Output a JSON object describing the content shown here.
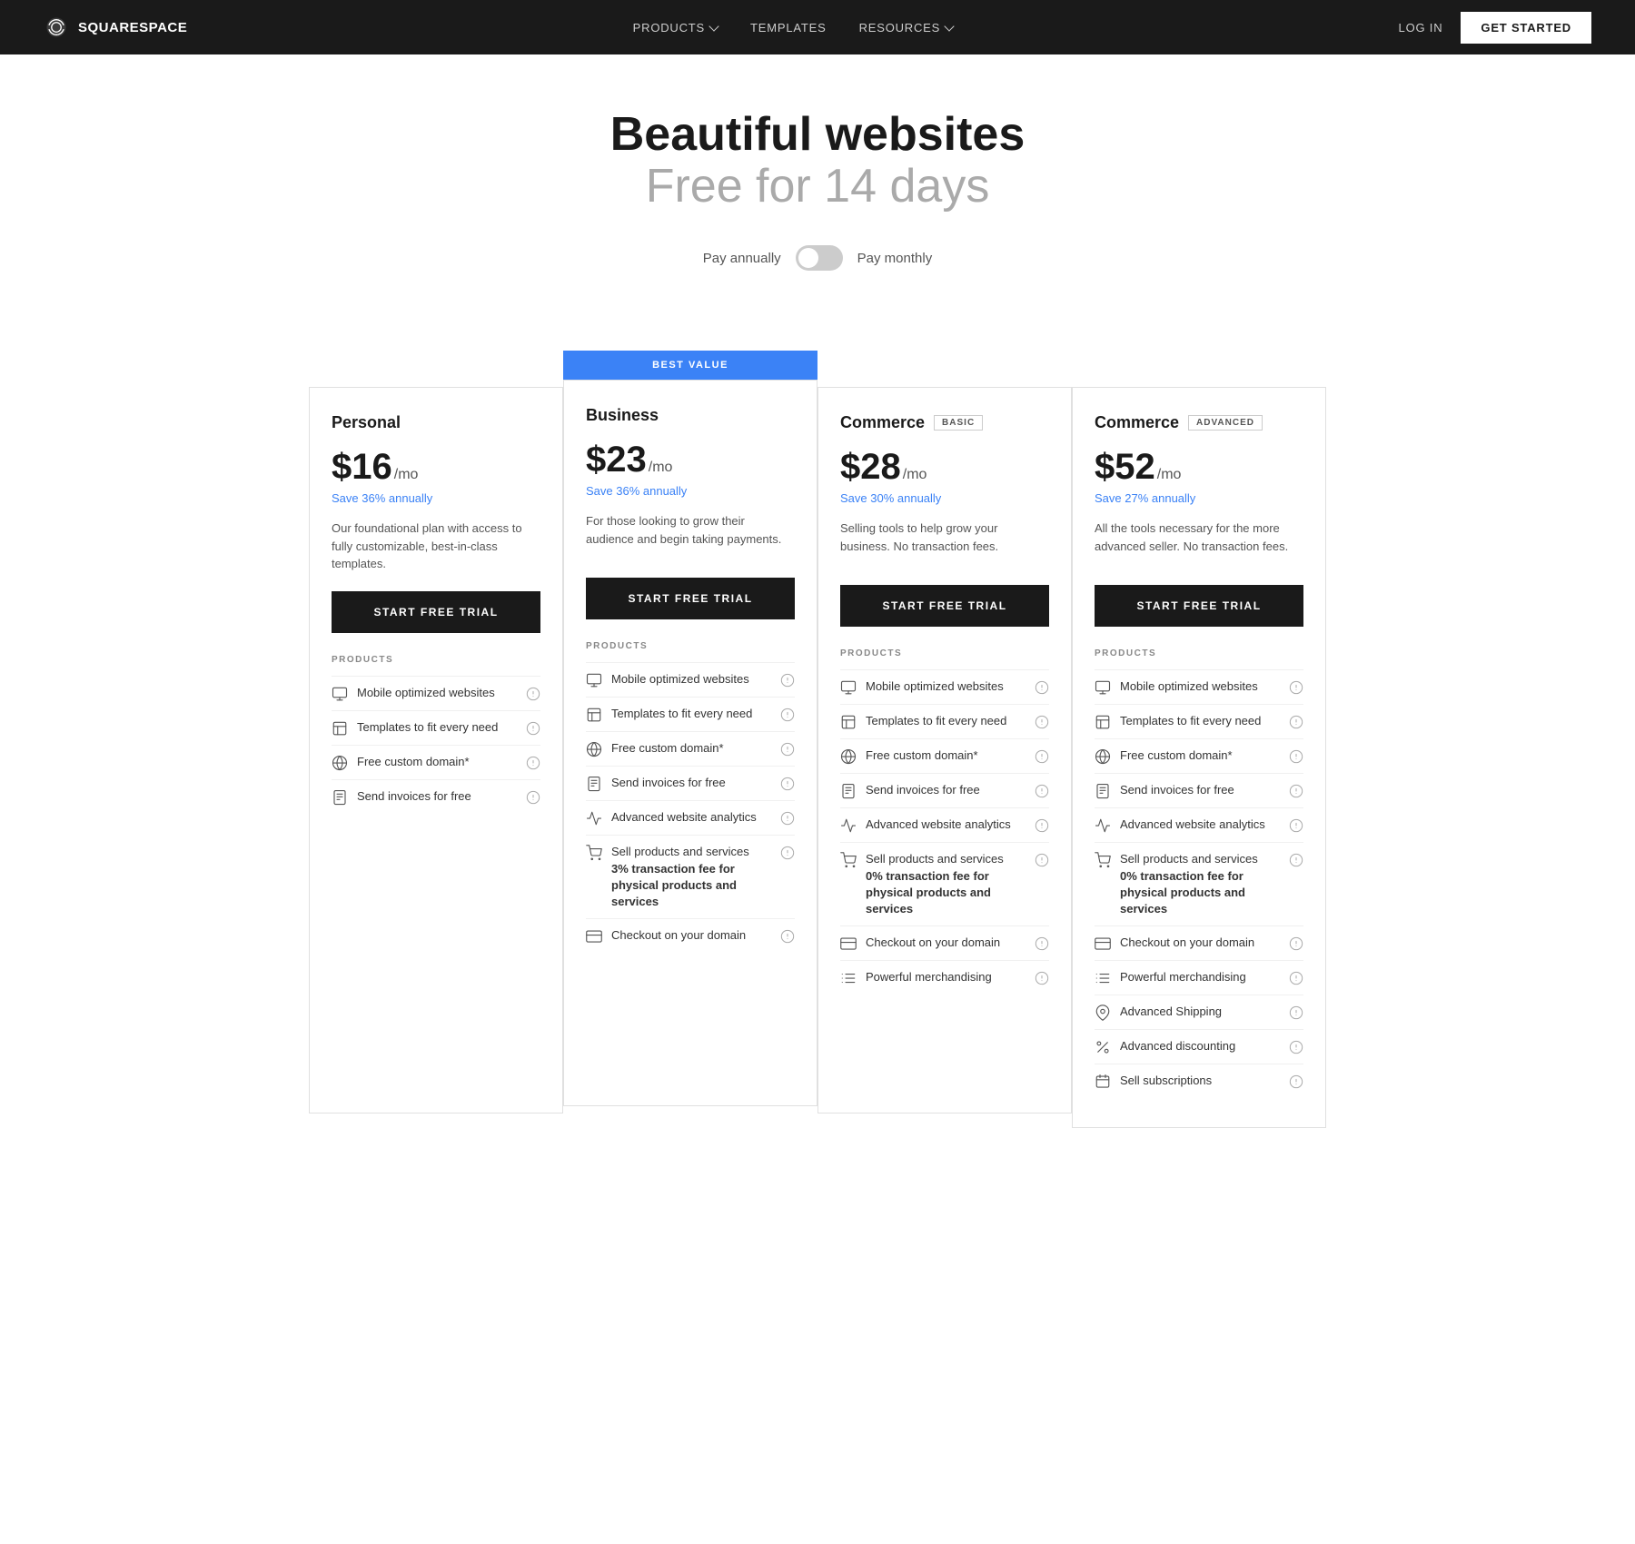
{
  "nav": {
    "logo_text": "SQUARESPACE",
    "links": [
      {
        "label": "PRODUCTS",
        "has_dropdown": true
      },
      {
        "label": "TEMPLATES",
        "has_dropdown": false
      },
      {
        "label": "RESOURCES",
        "has_dropdown": true
      }
    ],
    "login_label": "LOG IN",
    "cta_label": "GET STARTED"
  },
  "hero": {
    "line1": "Beautiful websites",
    "line2": "Free for 14 days"
  },
  "billing": {
    "annually_label": "Pay annually",
    "monthly_label": "Pay monthly"
  },
  "plans": [
    {
      "id": "personal",
      "name": "Personal",
      "badge": null,
      "best_value": false,
      "price": "$16",
      "per": "/mo",
      "save": "Save 36% annually",
      "desc": "Our foundational plan with access to fully customizable, best-in-class templates.",
      "cta": "START FREE TRIAL",
      "features_label": "PRODUCTS",
      "features": [
        {
          "icon": "monitor-icon",
          "text": "Mobile optimized websites",
          "bold_part": null
        },
        {
          "icon": "template-icon",
          "text": "Templates to fit every need",
          "bold_part": null
        },
        {
          "icon": "globe-icon",
          "text": "Free custom domain*",
          "bold_part": null
        },
        {
          "icon": "invoice-icon",
          "text": "Send invoices for free",
          "bold_part": null,
          "highlight": true
        }
      ]
    },
    {
      "id": "business",
      "name": "Business",
      "badge": null,
      "best_value": true,
      "price": "$23",
      "per": "/mo",
      "save": "Save 36% annually",
      "desc": "For those looking to grow their audience and begin taking payments.",
      "cta": "START FREE TRIAL",
      "features_label": "PRODUCTS",
      "features": [
        {
          "icon": "monitor-icon",
          "text": "Mobile optimized websites",
          "bold_part": null
        },
        {
          "icon": "template-icon",
          "text": "Templates to fit every need",
          "bold_part": null
        },
        {
          "icon": "globe-icon",
          "text": "Free custom domain*",
          "bold_part": null
        },
        {
          "icon": "invoice-icon",
          "text": "Send invoices for free",
          "bold_part": null
        },
        {
          "icon": "analytics-icon",
          "text": "Advanced website analytics",
          "bold_part": null
        },
        {
          "icon": "cart-icon",
          "text": "Sell products and services 3% transaction fee for physical products and services",
          "bold_part": "3% transaction fee for physical products and services"
        },
        {
          "icon": "credit-card-icon",
          "text": "Checkout on your domain",
          "bold_part": null
        }
      ]
    },
    {
      "id": "commerce-basic",
      "name": "Commerce",
      "badge": "BASIC",
      "best_value": false,
      "price": "$28",
      "per": "/mo",
      "save": "Save 30% annually",
      "desc": "Selling tools to help grow your business. No transaction fees.",
      "cta": "START FREE TRIAL",
      "features_label": "PRODUCTS",
      "features": [
        {
          "icon": "monitor-icon",
          "text": "Mobile optimized websites",
          "bold_part": null
        },
        {
          "icon": "template-icon",
          "text": "Templates to fit every need",
          "bold_part": null
        },
        {
          "icon": "globe-icon",
          "text": "Free custom domain*",
          "bold_part": null
        },
        {
          "icon": "invoice-icon",
          "text": "Send invoices for free",
          "bold_part": null
        },
        {
          "icon": "analytics-icon",
          "text": "Advanced website analytics",
          "bold_part": null
        },
        {
          "icon": "cart-icon",
          "text": "Sell products and services 0% transaction fee for physical products and services",
          "bold_part": "0% transaction fee for physical products and services"
        },
        {
          "icon": "credit-card-icon",
          "text": "Checkout on your domain",
          "bold_part": null
        },
        {
          "icon": "merchandising-icon",
          "text": "Powerful merchandising",
          "bold_part": null
        }
      ]
    },
    {
      "id": "commerce-advanced",
      "name": "Commerce",
      "badge": "ADVANCED",
      "best_value": false,
      "price": "$52",
      "per": "/mo",
      "save": "Save 27% annually",
      "desc": "All the tools necessary for the more advanced seller. No transaction fees.",
      "cta": "START FREE TRIAL",
      "features_label": "PRODUCTS",
      "features": [
        {
          "icon": "monitor-icon",
          "text": "Mobile optimized websites",
          "bold_part": null
        },
        {
          "icon": "template-icon",
          "text": "Templates to fit every need",
          "bold_part": null
        },
        {
          "icon": "globe-icon",
          "text": "Free custom domain*",
          "bold_part": null
        },
        {
          "icon": "invoice-icon",
          "text": "Send invoices for free",
          "bold_part": null
        },
        {
          "icon": "analytics-icon",
          "text": "Advanced website analytics",
          "bold_part": null
        },
        {
          "icon": "cart-icon",
          "text": "Sell products and services 0% transaction fee for physical products and services",
          "bold_part": "0% transaction fee for physical products and services"
        },
        {
          "icon": "credit-card-icon",
          "text": "Checkout on your domain",
          "bold_part": null
        },
        {
          "icon": "merchandising-icon",
          "text": "Powerful merchandising",
          "bold_part": null
        },
        {
          "icon": "shipping-icon",
          "text": "Advanced Shipping",
          "bold_part": null
        },
        {
          "icon": "discount-icon",
          "text": "Advanced discounting",
          "bold_part": null
        },
        {
          "icon": "subscription-icon",
          "text": "Sell subscriptions",
          "bold_part": null
        }
      ]
    }
  ]
}
